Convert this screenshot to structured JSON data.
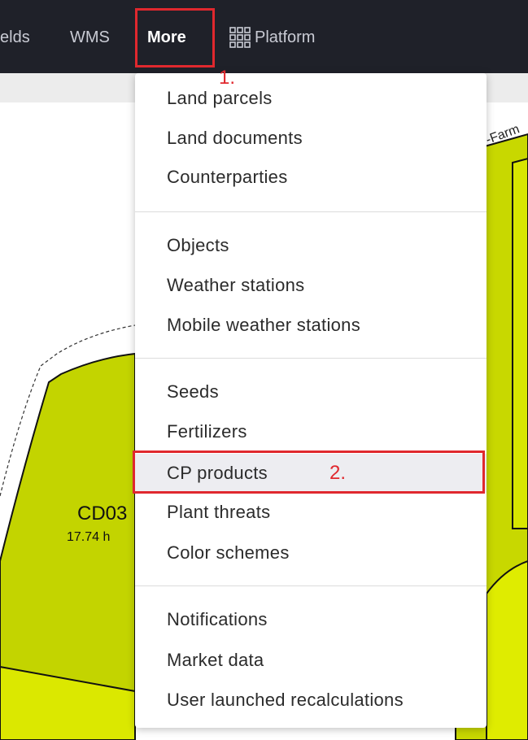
{
  "nav": {
    "fields": "elds",
    "wms": "WMS",
    "more": "More",
    "platform": "Platform",
    "platform_icon": "grid-icon"
  },
  "annotations": {
    "step1": "1.",
    "step2": "2.",
    "highlight_color": "#e0282e"
  },
  "map": {
    "field_id": "CD03",
    "field_area": "17.74 h",
    "farm_label": "-Farm",
    "field_color": "#c3d400",
    "field_color_light": "#dbe800"
  },
  "menu": {
    "groups": [
      [
        "Land parcels",
        "Land documents",
        "Counterparties"
      ],
      [
        "Objects",
        "Weather stations",
        "Mobile weather stations"
      ],
      [
        "Seeds",
        "Fertilizers",
        "CP products",
        "Plant threats",
        "Color schemes"
      ],
      [
        "Notifications",
        "Market data",
        "User launched recalculations"
      ]
    ],
    "active_item": "CP products"
  }
}
